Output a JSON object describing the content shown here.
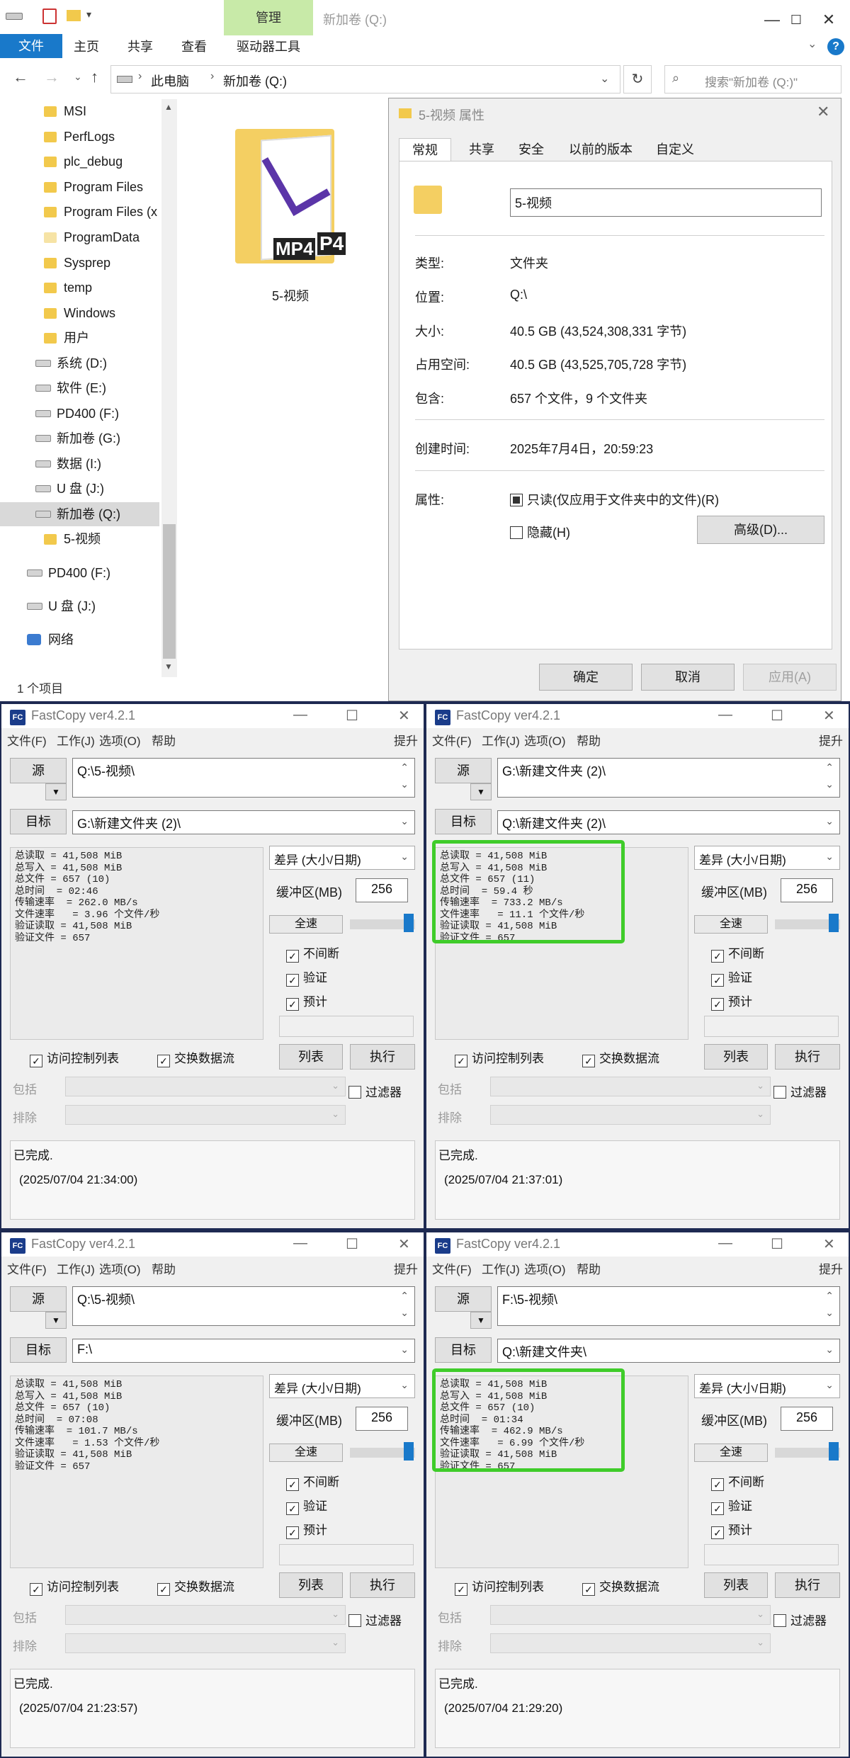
{
  "explorer": {
    "window_title": "新加卷 (Q:)",
    "ribbon_context": "管理",
    "tabs": [
      "文件",
      "主页",
      "共享",
      "查看",
      "驱动器工具"
    ],
    "breadcrumb": [
      "此电脑",
      "新加卷 (Q:)"
    ],
    "search_placeholder": "搜索\"新加卷 (Q:)\"",
    "tree": [
      {
        "label": "MSI",
        "type": "folder"
      },
      {
        "label": "PerfLogs",
        "type": "folder"
      },
      {
        "label": "plc_debug",
        "type": "folder"
      },
      {
        "label": "Program Files",
        "type": "folder"
      },
      {
        "label": "Program Files (x",
        "type": "folder"
      },
      {
        "label": "ProgramData",
        "type": "folder"
      },
      {
        "label": "Sysprep",
        "type": "folder"
      },
      {
        "label": "temp",
        "type": "folder"
      },
      {
        "label": "Windows",
        "type": "folder"
      },
      {
        "label": "用户",
        "type": "folder"
      },
      {
        "label": "系统 (D:)",
        "type": "drive"
      },
      {
        "label": "软件 (E:)",
        "type": "drive"
      },
      {
        "label": "PD400 (F:)",
        "type": "drive"
      },
      {
        "label": "新加卷 (G:)",
        "type": "drive"
      },
      {
        "label": "数据 (I:)",
        "type": "drive"
      },
      {
        "label": "U 盘 (J:)",
        "type": "drive"
      },
      {
        "label": "新加卷 (Q:)",
        "type": "drive"
      },
      {
        "label": "5-视频",
        "type": "folder"
      },
      {
        "label": "PD400 (F:)",
        "type": "drive"
      },
      {
        "label": "U 盘 (J:)",
        "type": "drive"
      },
      {
        "label": "网络",
        "type": "network"
      }
    ],
    "folder_name": "5-视频",
    "folder_badges": [
      "MP4",
      "P4"
    ],
    "status": "1 个项目"
  },
  "props": {
    "title": "5-视频 属性",
    "tabs": [
      "常规",
      "共享",
      "安全",
      "以前的版本",
      "自定义"
    ],
    "name_value": "5-视频",
    "rows": [
      {
        "label": "类型:",
        "value": "文件夹"
      },
      {
        "label": "位置:",
        "value": "Q:\\"
      },
      {
        "label": "大小:",
        "value": "40.5 GB (43,524,308,331 字节)"
      },
      {
        "label": "占用空间:",
        "value": "40.5 GB (43,525,705,728 字节)"
      },
      {
        "label": "包含:",
        "value": "657 个文件，9 个文件夹"
      }
    ],
    "created_label": "创建时间:",
    "created_value": "2025年7月4日，20:59:23",
    "attr_label": "属性:",
    "readonly_label": "只读(仅应用于文件夹中的文件)(R)",
    "hidden_label": "隐藏(H)",
    "advanced_btn": "高级(D)...",
    "ok_btn": "确定",
    "cancel_btn": "取消",
    "apply_btn": "应用(A)"
  },
  "fastcopy_common": {
    "title": "FastCopy ver4.2.1",
    "menu": [
      "文件(F)",
      "工作(J)",
      "选项(O)",
      "帮助"
    ],
    "menu_right": "提升",
    "src_btn": "源",
    "dst_btn": "目标",
    "mode": "差异 (大小/日期)",
    "buffer_label": "缓冲区(MB)",
    "buffer_value": "256",
    "fullspeed_btn": "全速",
    "chk_nonstop": "不间断",
    "chk_verify": "验证",
    "chk_estimate": "预计",
    "list_btn": "列表",
    "exec_btn": "执行",
    "chk_acl": "访问控制列表",
    "chk_stream": "交换数据流",
    "include_label": "包括",
    "exclude_label": "排除",
    "filter_label": "过滤器",
    "done": "已完成."
  },
  "fastcopy": [
    {
      "source": "Q:\\5-视频\\",
      "dest": "G:\\新建文件夹 (2)\\",
      "stats": "总读取 = 41,508 MiB\n总写入 = 41,508 MiB\n总文件 = 657 (10)\n总时间  = 02:46\n传输速率  = 262.0 MB/s\n文件速率   = 3.96 个文件/秒\n验证读取 = 41,508 MiB\n验证文件 = 657",
      "highlight": false,
      "timestamp": "(2025/07/04 21:34:00)"
    },
    {
      "source": "G:\\新建文件夹 (2)\\",
      "dest": "Q:\\新建文件夹 (2)\\",
      "stats": "总读取 = 41,508 MiB\n总写入 = 41,508 MiB\n总文件 = 657 (11)\n总时间  = 59.4 秒\n传输速率  = 733.2 MB/s\n文件速率   = 11.1 个文件/秒\n验证读取 = 41,508 MiB\n验证文件 = 657",
      "highlight": true,
      "timestamp": "(2025/07/04 21:37:01)"
    },
    {
      "source": "Q:\\5-视频\\",
      "dest": "F:\\",
      "stats": "总读取 = 41,508 MiB\n总写入 = 41,508 MiB\n总文件 = 657 (10)\n总时间  = 07:08\n传输速率  = 101.7 MB/s\n文件速率   = 1.53 个文件/秒\n验证读取 = 41,508 MiB\n验证文件 = 657",
      "highlight": false,
      "timestamp": "(2025/07/04 21:23:57)"
    },
    {
      "source": "F:\\5-视频\\",
      "dest": "Q:\\新建文件夹\\",
      "stats": "总读取 = 41,508 MiB\n总写入 = 41,508 MiB\n总文件 = 657 (10)\n总时间  = 01:34\n传输速率  = 462.9 MB/s\n文件速率   = 6.99 个文件/秒\n验证读取 = 41,508 MiB\n验证文件 = 657",
      "highlight": true,
      "timestamp": "(2025/07/04 21:29:20)"
    }
  ],
  "colors": {
    "accent": "#1979ca",
    "ribbon_manage": "#c8eaa8",
    "highlight_box": "#3fcc2a",
    "frame": "#1e2a52"
  },
  "icons": {
    "folder": "folder-icon",
    "drive": "drive-icon",
    "network": "network-icon",
    "fastcopy": "fastcopy-logo-icon"
  }
}
